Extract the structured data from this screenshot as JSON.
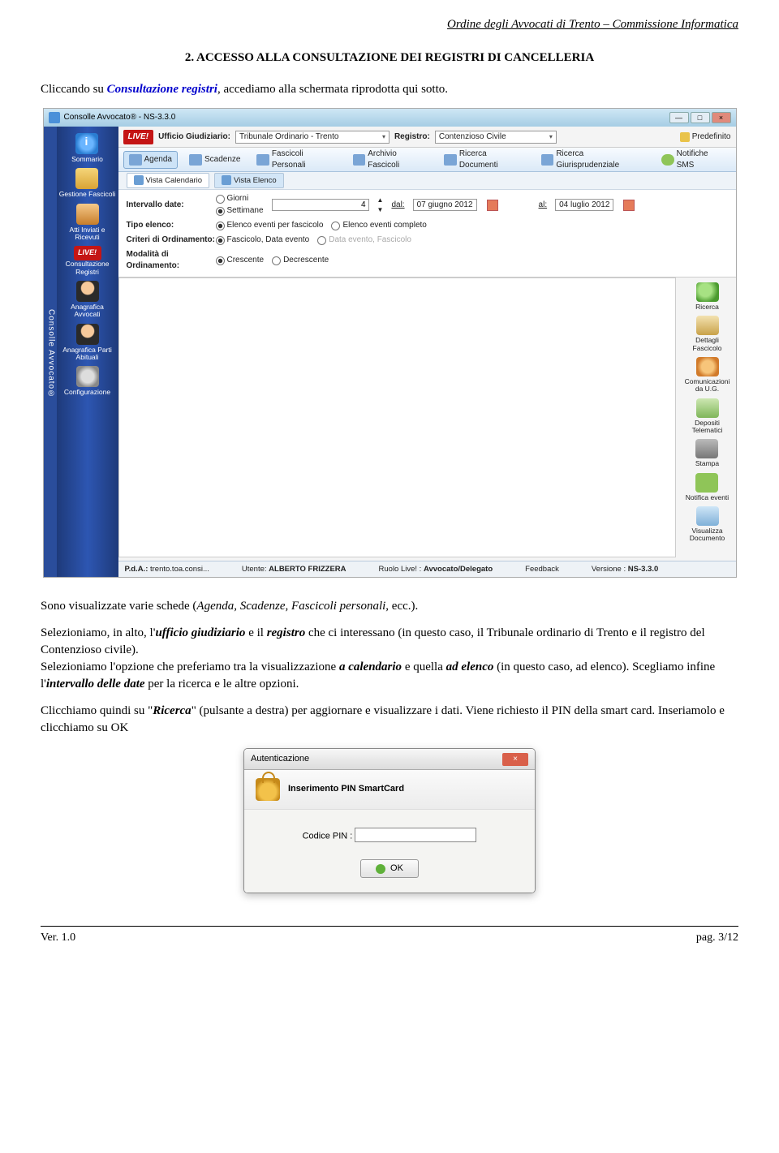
{
  "header": "Ordine degli Avvocati di Trento – Commissione Informatica",
  "section_title": "2. ACCESSO ALLA CONSULTAZIONE DEI REGISTRI DI CANCELLERIA",
  "intro_plain1": "Cliccando su ",
  "intro_link": "Consultazione registri",
  "intro_plain2": ", accediamo alla schermata riprodotta qui sotto.",
  "app": {
    "window_title": "Consolle Avvocato® - NS-3.3.0",
    "side_strip": "Consolle Avvocato®",
    "sidebar": [
      {
        "label": "Sommario"
      },
      {
        "label": "Gestione Fascicoli"
      },
      {
        "label": "Atti Inviati e Ricevuti"
      },
      {
        "label": "Consultazione Registri",
        "live": true
      },
      {
        "label": "Anagrafica Avvocati"
      },
      {
        "label": "Anagrafica Parti Abituali"
      },
      {
        "label": "Configurazione"
      }
    ],
    "topbar": {
      "live": "LIVE!",
      "lab_ug": "Ufficio Giudiziario:",
      "val_ug": "Tribunale Ordinario - Trento",
      "lab_reg": "Registro:",
      "val_reg": "Contenzioso Civile",
      "predef": "Predefinito"
    },
    "tabs": [
      "Agenda",
      "Scadenze",
      "Fascicoli Personali",
      "Archivio Fascicoli",
      "Ricerca Documenti",
      "Ricerca Giurisprudenziale",
      "Notifiche SMS"
    ],
    "subview": {
      "cal": "Vista Calendario",
      "list": "Vista Elenco"
    },
    "filters": {
      "lab_interval": "Intervallo date:",
      "opt_giorni": "Giorni",
      "opt_settimane": "Settimane",
      "num": "4",
      "lab_dal": "dal:",
      "val_dal": "07 giugno 2012",
      "lab_al": "al:",
      "val_al": "04 luglio 2012",
      "lab_tipo": "Tipo elenco:",
      "tipo_a": "Elenco eventi per fascicolo",
      "tipo_b": "Elenco eventi completo",
      "lab_crit": "Criteri di Ordinamento:",
      "crit_a": "Fascicolo, Data evento",
      "crit_b": "Data evento, Fascicolo",
      "lab_mod": "Modalità di Ordinamento:",
      "mod_a": "Crescente",
      "mod_b": "Decrescente"
    },
    "right": [
      {
        "label": "Ricerca",
        "cls": "ri-search"
      },
      {
        "label": "Dettagli Fascicolo",
        "cls": "ri-doc"
      },
      {
        "label": "Comunicazioni da U.G.",
        "cls": "ri-comm"
      },
      {
        "label": "Depositi Telematici",
        "cls": "ri-dep"
      },
      {
        "label": "Stampa",
        "cls": "ri-print"
      },
      {
        "label": "Notifica eventi",
        "cls": "ri-sms"
      },
      {
        "label": "Visualizza Documento",
        "cls": "ri-view"
      }
    ],
    "status": {
      "pda_l": "P.d.A.:",
      "pda_v": "trento.toa.consi...",
      "ut_l": "Utente:",
      "ut_v": "ALBERTO FRIZZERA",
      "rl_l": "Ruolo Live! :",
      "rl_v": "Avvocato/Delegato",
      "fb": "Feedback",
      "ver_l": "Versione :",
      "ver_v": "NS-3.3.0"
    }
  },
  "para2_pre": "Sono visualizzate varie schede (",
  "para2_em": "Agenda, Scadenze, Fascicoli personali",
  "para2_post": ", ecc.).",
  "para3": {
    "t1": "Selezioniamo, in alto, l'",
    "b1": "ufficio giudiziario",
    "t2": " e il ",
    "b2": "registro",
    "t3": " che ci interessano (in questo caso, il Tribunale ordinario di Trento e il registro del Contenzioso civile).",
    "t4": "Selezioniamo l'opzione che preferiamo tra la visualizzazione ",
    "b3": "a calendario",
    "t5": " e quella ",
    "b4": "ad elenco",
    "t6": " (in questo caso, ad elenco). Scegliamo infine l'",
    "b5": "intervallo delle date",
    "t7": " per la ricerca e le altre opzioni."
  },
  "para4": {
    "t1": "Clicchiamo quindi su \"",
    "b1": "Ricerca",
    "t2": "\" (pulsante a destra) per aggiornare e visualizzare i dati. Viene richiesto il PIN della smart card. Inseriamolo e clicchiamo su OK"
  },
  "dialog": {
    "title": "Autenticazione",
    "head": "Inserimento PIN SmartCard",
    "field_label": "Codice PIN :",
    "ok": "OK"
  },
  "footer": {
    "left": "Ver. 1.0",
    "right": "pag. 3/12"
  }
}
